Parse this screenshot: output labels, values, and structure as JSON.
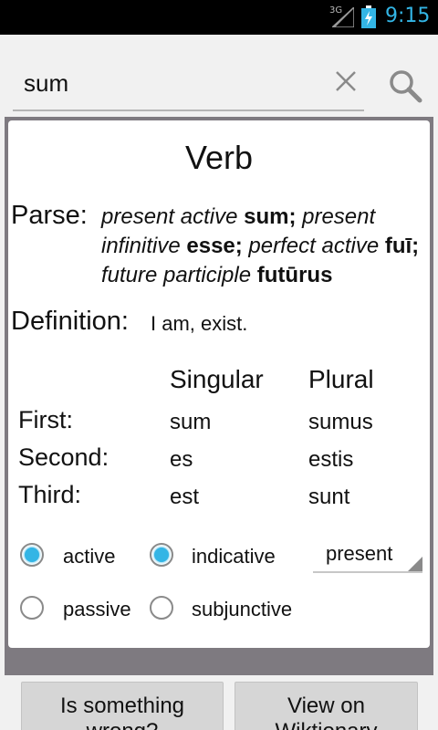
{
  "status_bar": {
    "network": "3G",
    "time": "9:15"
  },
  "search": {
    "value": "sum"
  },
  "entry": {
    "title": "Verb",
    "parse_label": "Parse:",
    "parse": [
      {
        "text": "present active ",
        "style": "italic"
      },
      {
        "text": "sum;",
        "style": "bold"
      },
      {
        "text": " present infinitive ",
        "style": "italic"
      },
      {
        "text": "esse;",
        "style": "bold"
      },
      {
        "text": " perfect active ",
        "style": "italic"
      },
      {
        "text": "fuī;",
        "style": "bold"
      },
      {
        "text": " future participle ",
        "style": "italic"
      },
      {
        "text": "futūrus",
        "style": "bold"
      }
    ],
    "definition_label": "Definition:",
    "definition": "I am, exist."
  },
  "conjugation": {
    "headers": {
      "singular": "Singular",
      "plural": "Plural"
    },
    "rows": [
      {
        "label": "First:",
        "singular": "sum",
        "plural": "sumus"
      },
      {
        "label": "Second:",
        "singular": "es",
        "plural": "estis"
      },
      {
        "label": "Third:",
        "singular": "est",
        "plural": "sunt"
      }
    ]
  },
  "options": {
    "voice": {
      "active": "active",
      "passive": "passive",
      "selected": "active"
    },
    "mood": {
      "indicative": "indicative",
      "subjunctive": "subjunctive",
      "selected": "indicative"
    },
    "tense": {
      "selected": "present"
    }
  },
  "buttons": {
    "wrong": "Is something wrong?",
    "wiktionary": "View on Wiktionary"
  },
  "colors": {
    "accent": "#33b5e5",
    "card_frame": "#7e7a80"
  }
}
